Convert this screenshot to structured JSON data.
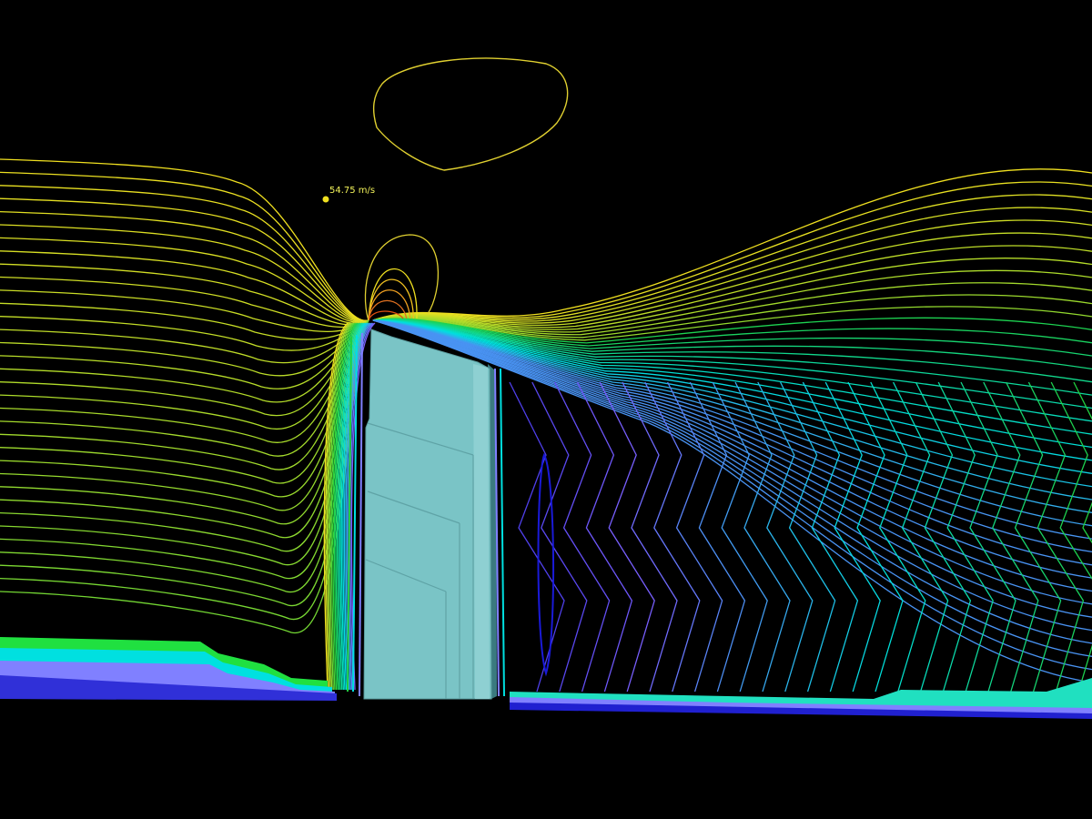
{
  "probe": {
    "label": "54.75 m/s",
    "color": "#f0e020"
  },
  "palette": {
    "background": "#000000",
    "building_face": "#7ac4c6",
    "building_edge": "#5c9ea0",
    "low": "#1010d0",
    "mid": "#00e0e0",
    "green": "#20d040",
    "high": "#f0e020",
    "peak": "#e05010"
  }
}
